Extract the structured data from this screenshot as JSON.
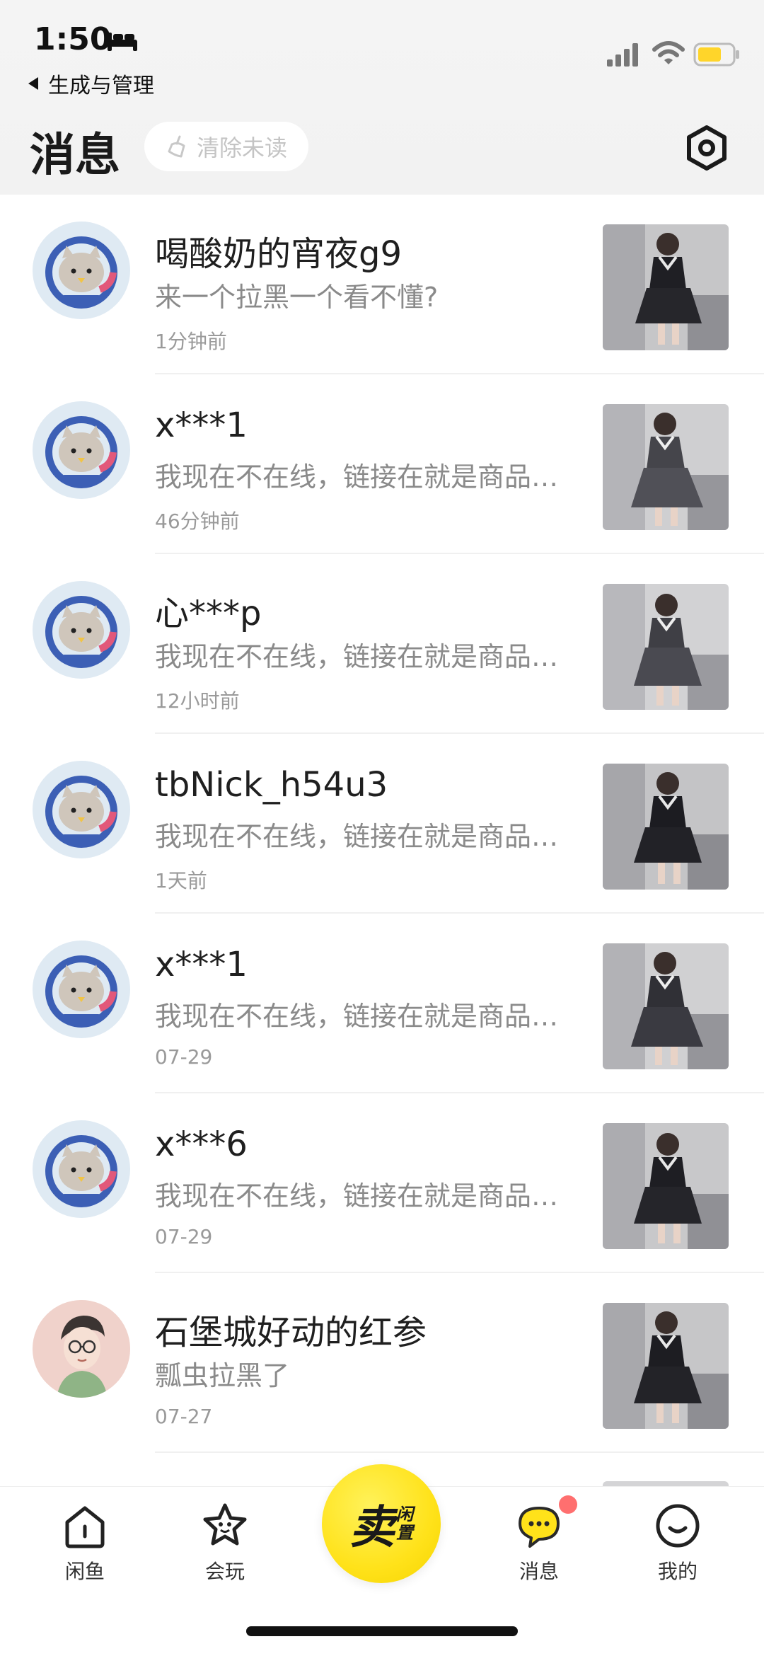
{
  "status_bar": {
    "time": "1:50",
    "icons": [
      "bed-icon",
      "signal-icon",
      "wifi-icon",
      "battery-icon"
    ]
  },
  "header": {
    "back_label": "生成与管理",
    "title": "消息",
    "clear_unread_label": "清除未读"
  },
  "conversations": [
    {
      "name": "喝酸奶的宵夜g9",
      "preview": "来一个拉黑一个看不懂?",
      "time": "1分钟前"
    },
    {
      "name": "x***1",
      "preview": "我现在不在线，链接在就是商品还在，可以直接拍下哦",
      "time": "46分钟前"
    },
    {
      "name": "心***p",
      "preview": "我现在不在线，链接在就是商品还在，可以直接拍下哦",
      "time": "12小时前"
    },
    {
      "name": "tbNick_h54u3",
      "preview": "我现在不在线，链接在就是商品还在，可以直接拍下哦",
      "time": "1天前"
    },
    {
      "name": "x***1",
      "preview": "我现在不在线，链接在就是商品还在，可以直接拍下哦",
      "time": "07-29"
    },
    {
      "name": "x***6",
      "preview": "我现在不在线，链接在就是商品还在，可以直接拍下哦",
      "time": "07-29"
    },
    {
      "name": "石堡城好动的红参",
      "preview": "瓢虫拉黑了",
      "time": "07-27"
    }
  ],
  "tabbar": {
    "home": "闲鱼",
    "play": "会玩",
    "sell_main": "卖",
    "sell_sub1": "闲",
    "sell_sub2": "置",
    "messages": "消息",
    "mine": "我的"
  },
  "colors": {
    "accent_yellow": "#ffe21a",
    "badge_red": "#ff6f6f",
    "text_gray": "#8a8a8a"
  }
}
